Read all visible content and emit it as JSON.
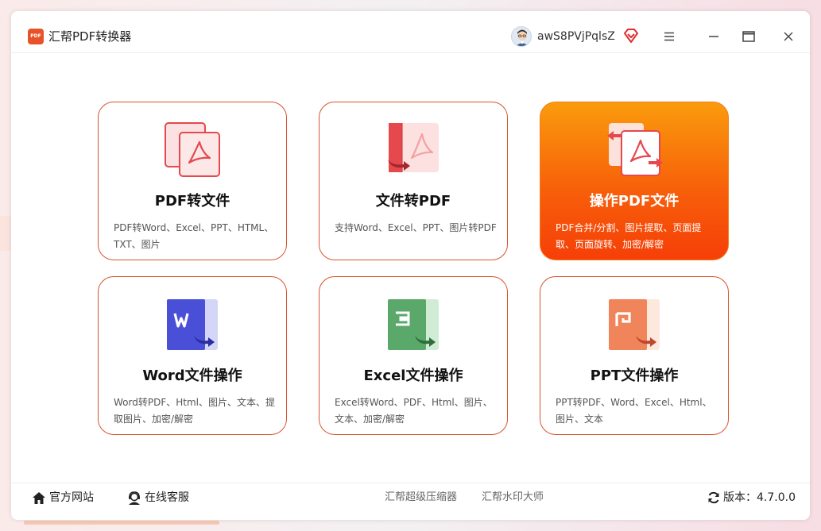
{
  "window": {
    "title": "汇帮PDF转换器",
    "logo_text": "PDF",
    "username": "awS8PVjPqlsZ"
  },
  "colors": {
    "accent": "#f7600a",
    "border": "#d9532c",
    "word": "#4a4fd8",
    "excel": "#5aa86a",
    "ppt": "#f0845a",
    "pdf_red": "#e5484d"
  },
  "cards": [
    {
      "icon": "pdf-to-file-icon",
      "title": "PDF转文件",
      "desc": "PDF转Word、Excel、PPT、HTML、TXT、图片"
    },
    {
      "icon": "file-to-pdf-icon",
      "title": "文件转PDF",
      "desc": "支持Word、Excel、PPT、图片转PDF"
    },
    {
      "icon": "pdf-operate-icon",
      "title": "操作PDF文件",
      "desc": "PDF合并/分割、图片提取、页面提取、页面旋转、加密/解密"
    },
    {
      "icon": "word-icon",
      "title": "Word文件操作",
      "desc": "Word转PDF、Html、图片、文本、提取图片、加密/解密"
    },
    {
      "icon": "excel-icon",
      "title": "Excel文件操作",
      "desc": "Excel转Word、PDF、Html、图片、文本、加密/解密"
    },
    {
      "icon": "ppt-icon",
      "title": "PPT文件操作",
      "desc": "PPT转PDF、Word、Excel、Html、图片、文本"
    }
  ],
  "footer": {
    "official_site": "官方网站",
    "online_service": "在线客服",
    "link1": "汇帮超级压缩器",
    "link2": "汇帮水印大师",
    "version": "版本：4.7.0.0"
  }
}
